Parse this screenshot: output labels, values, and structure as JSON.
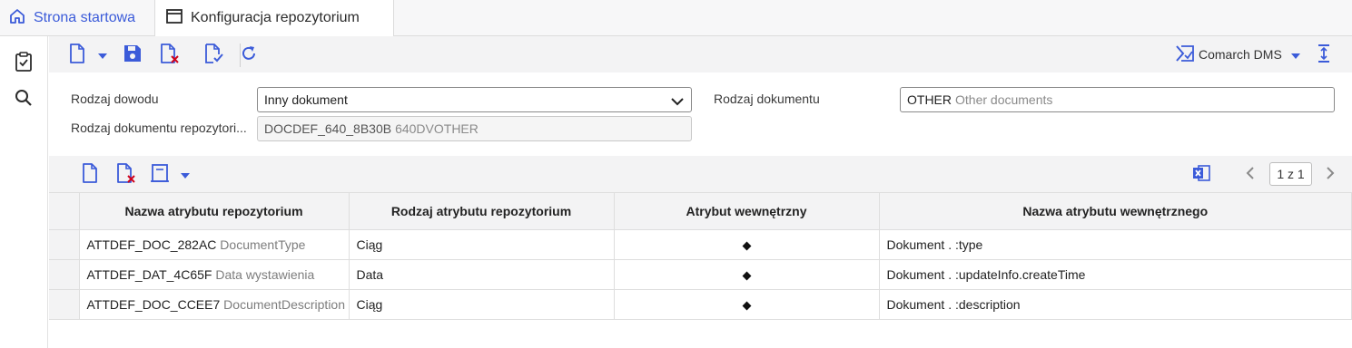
{
  "tabs": [
    {
      "label": "Strona startowa",
      "icon": "home-icon"
    },
    {
      "label": "Konfiguracja repozytorium",
      "icon": "window-icon"
    }
  ],
  "toolbar": {
    "dms_label": "Comarch DMS"
  },
  "form": {
    "evidence_type": {
      "label": "Rodzaj dowodu",
      "value": "Inny dokument"
    },
    "document_type": {
      "label": "Rodzaj dokumentu",
      "code": "OTHER",
      "desc": "Other documents"
    },
    "repo_doc_type": {
      "label": "Rodzaj dokumentu repozytori...",
      "code": "DOCDEF_640_8B30B",
      "desc": "640DVOTHER"
    }
  },
  "grid": {
    "pager": "1 z 1",
    "columns": [
      "Nazwa atrybutu repozytorium",
      "Rodzaj atrybutu repozytorium",
      "Atrybut wewnętrzny",
      "Nazwa atrybutu wewnętrznego"
    ],
    "rows": [
      {
        "code": "ATTDEF_DOC_282AC",
        "desc": "DocumentType",
        "type": "Ciąg",
        "internal": true,
        "internal_name": "Dokument . :type"
      },
      {
        "code": "ATTDEF_DAT_4C65F",
        "desc": "Data wystawienia",
        "type": "Data",
        "internal": true,
        "internal_name": "Dokument . :updateInfo.createTime"
      },
      {
        "code": "ATTDEF_DOC_CCEE7",
        "desc": "DocumentDescription",
        "type": "Ciąg",
        "internal": true,
        "internal_name": "Dokument . :description"
      }
    ]
  },
  "colors": {
    "accent": "#3b5bd9",
    "delete": "#d0021b"
  }
}
